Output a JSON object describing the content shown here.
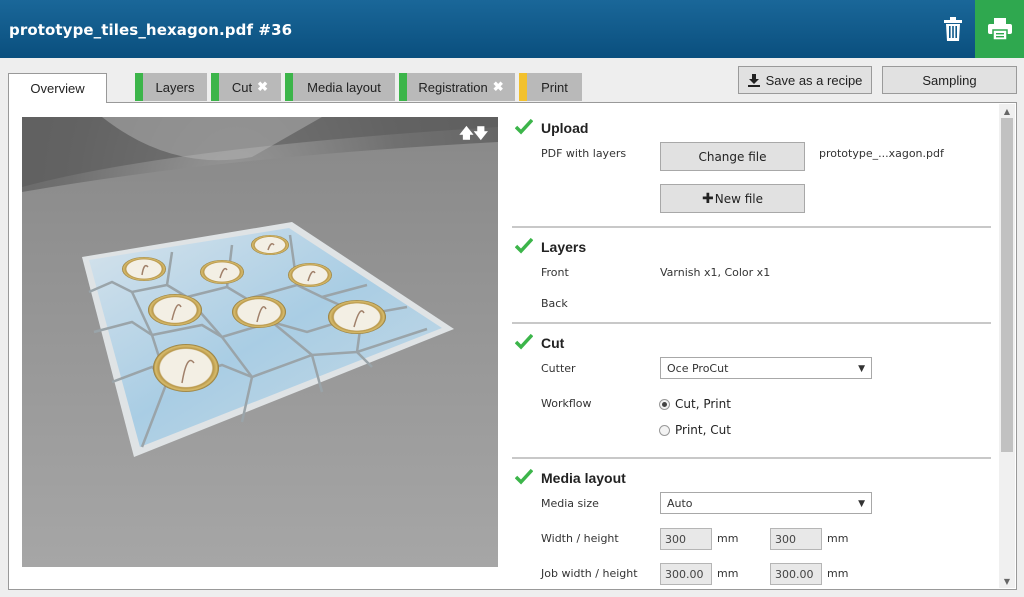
{
  "header": {
    "title": "prototype_tiles_hexagon.pdf #36"
  },
  "tabs": [
    {
      "label": "Overview",
      "active": true
    },
    {
      "label": "Layers",
      "status_color": "#3cb54a",
      "error": false
    },
    {
      "label": "Cut",
      "status_color": "#3cb54a",
      "error": true
    },
    {
      "label": "Media layout",
      "status_color": "#3cb54a",
      "error": false
    },
    {
      "label": "Registration",
      "status_color": "#3cb54a",
      "error": true
    },
    {
      "label": "Print",
      "status_color": "#f2c12e",
      "error": false
    }
  ],
  "toolbar": {
    "save_recipe_label": "Save as a recipe",
    "sampling_label": "Sampling"
  },
  "upload": {
    "title": "Upload",
    "pdf_label": "PDF with layers",
    "change_file_label": "Change file",
    "filename": "prototype_...xagon.pdf",
    "new_file_label": "New file"
  },
  "layers": {
    "title": "Layers",
    "front_label": "Front",
    "front_value": "Varnish x1, Color x1",
    "back_label": "Back"
  },
  "cut": {
    "title": "Cut",
    "cutter_label": "Cutter",
    "cutter_value": "Oce ProCut",
    "workflow_label": "Workflow",
    "workflow_options": [
      {
        "label": "Cut, Print",
        "selected": true
      },
      {
        "label": "Print, Cut",
        "selected": false
      }
    ]
  },
  "media_layout": {
    "title": "Media layout",
    "media_size_label": "Media size",
    "media_size_value": "Auto",
    "width_height_label": "Width / height",
    "width_value": "300",
    "height_value": "300",
    "job_width_height_label": "Job width / height",
    "job_width_value": "300.00",
    "job_height_value": "300.00",
    "unit": "mm"
  },
  "colors": {
    "header": "#0f5a8a",
    "print_button": "#2fa84f",
    "check": "#3cb54a",
    "print_tab": "#f2c12e"
  }
}
